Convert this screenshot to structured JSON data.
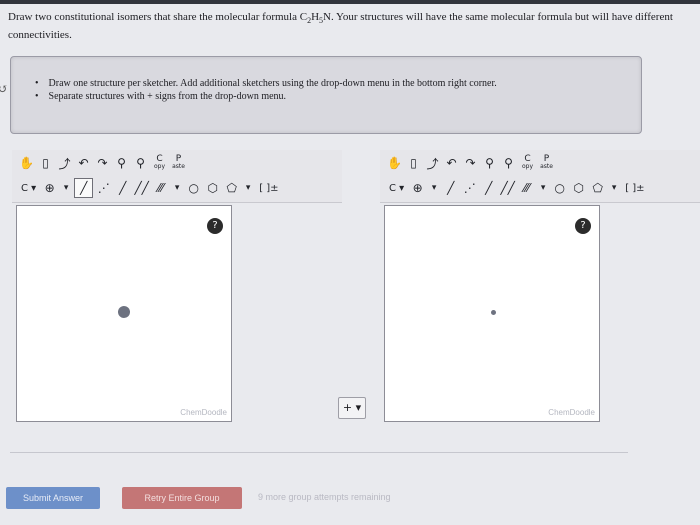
{
  "question": {
    "text_before": "Draw two constitutional isomers that share the molecular formula C",
    "sub1": "2",
    "mid1": "H",
    "sub2": "5",
    "text_after": "N. Your structures will have the same molecular formula but will have different connectivities."
  },
  "instructions": [
    "Draw one structure per sketcher. Add additional sketchers using the drop-down menu in the bottom right corner.",
    "Separate structures with + signs from the drop-down menu."
  ],
  "toolbar": {
    "copy_label_top": "C",
    "copy_label_bottom": "opy",
    "paste_label_top": "P",
    "paste_label_bottom": "aste",
    "carbon_label": "C",
    "bracket_label": "[ ]±"
  },
  "canvas": {
    "watermark": "ChemDoodle",
    "help_symbol": "?"
  },
  "add_button_label": "+ ▾",
  "buttons": {
    "submit": "Submit Answer",
    "retry": "Retry Entire Group"
  },
  "attempts_text": "9 more group attempts remaining"
}
